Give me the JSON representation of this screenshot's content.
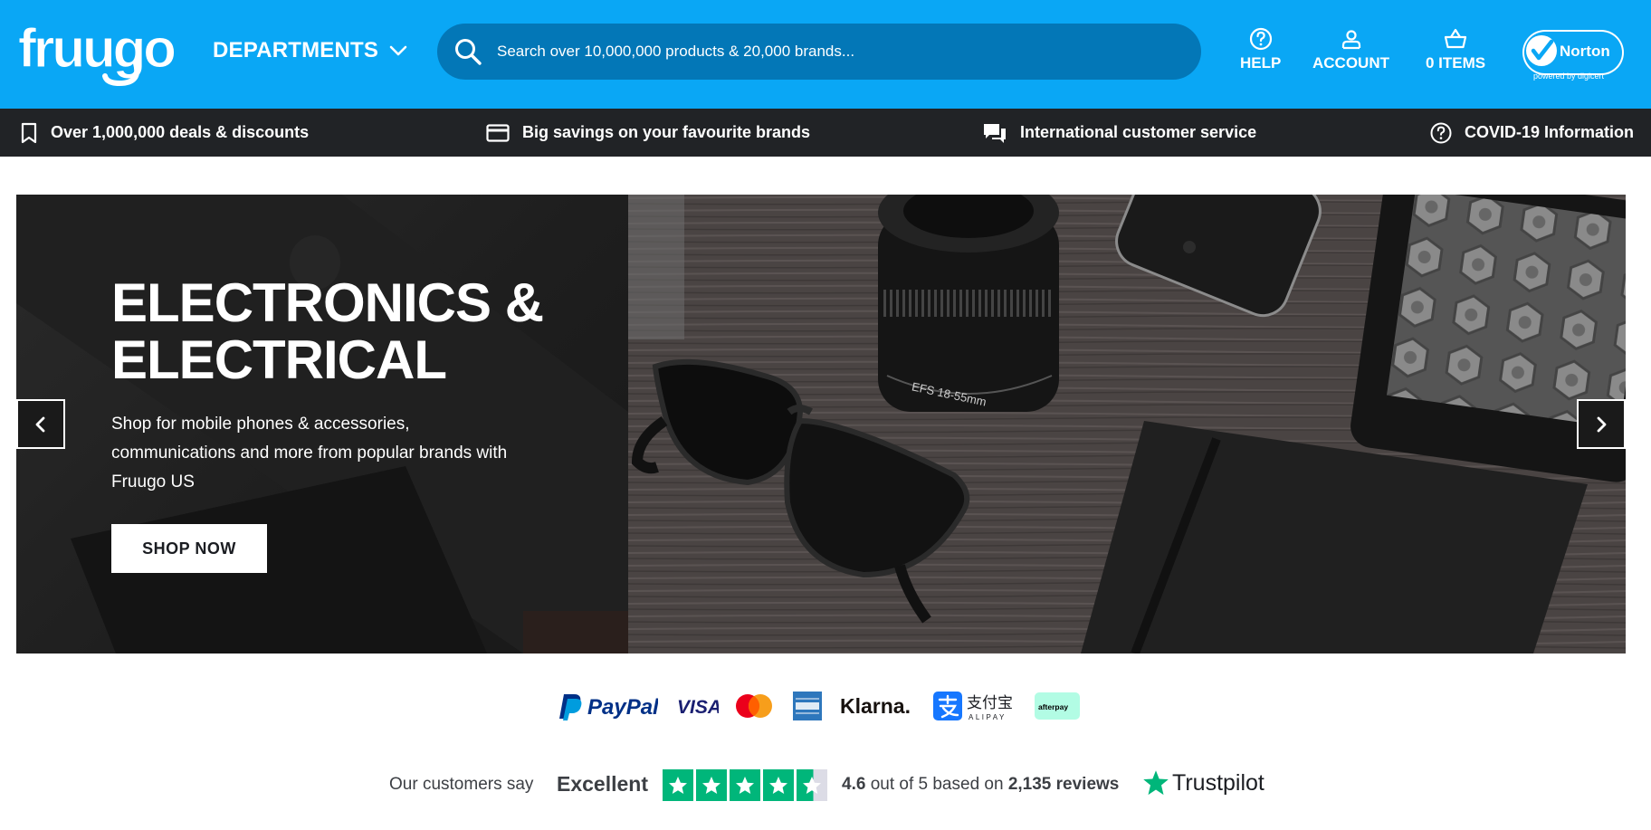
{
  "header": {
    "logo_text": "fruugo",
    "departments_label": "DEPARTMENTS",
    "search_placeholder": "Search over 10,000,000 products & 20,000 brands...",
    "help_label": "HELP",
    "account_label": "ACCOUNT",
    "cart_label": "0 ITEMS",
    "norton": {
      "name": "Norton",
      "tagline": "powered by digicert"
    }
  },
  "infobar": {
    "items": [
      {
        "label": "Over 1,000,000 deals & discounts",
        "icon": "bookmark-icon"
      },
      {
        "label": "Big savings on your favourite brands",
        "icon": "credit-card-icon"
      },
      {
        "label": "International customer service",
        "icon": "chat-icon"
      },
      {
        "label": "COVID-19 Information",
        "icon": "help-circle-icon"
      }
    ]
  },
  "hero": {
    "title_line1": "ELECTRONICS &",
    "title_line2": "ELECTRICAL",
    "description": "Shop for mobile phones & accessories, communications and more from popular brands with Fruugo US",
    "cta_label": "SHOP NOW"
  },
  "payments": {
    "methods": [
      "PayPal",
      "VISA",
      "Mastercard",
      "American Express",
      "Klarna.",
      "Alipay",
      "afterpay"
    ],
    "paypal_text": "PayPal",
    "visa_text": "VISA",
    "klarna_text": "Klarna.",
    "alipay_cn": "支付宝",
    "alipay_en": "ALIPAY",
    "afterpay_text": "afterpay"
  },
  "trustpilot": {
    "intro": "Our customers say",
    "verdict": "Excellent",
    "score": "4.6",
    "score_suffix": "out of 5 based on",
    "review_count": "2,135 reviews",
    "stars": 4.5,
    "brand": "Trustpilot"
  },
  "colors": {
    "brand_blue": "#0aa7f5",
    "search_bg": "#0377b7",
    "infobar_bg": "#212326",
    "trustpilot_green": "#00b67a",
    "paypal_dark": "#003087",
    "paypal_light": "#009cde",
    "alipay_blue": "#1677ff",
    "afterpay_mint": "#b2fce4"
  }
}
